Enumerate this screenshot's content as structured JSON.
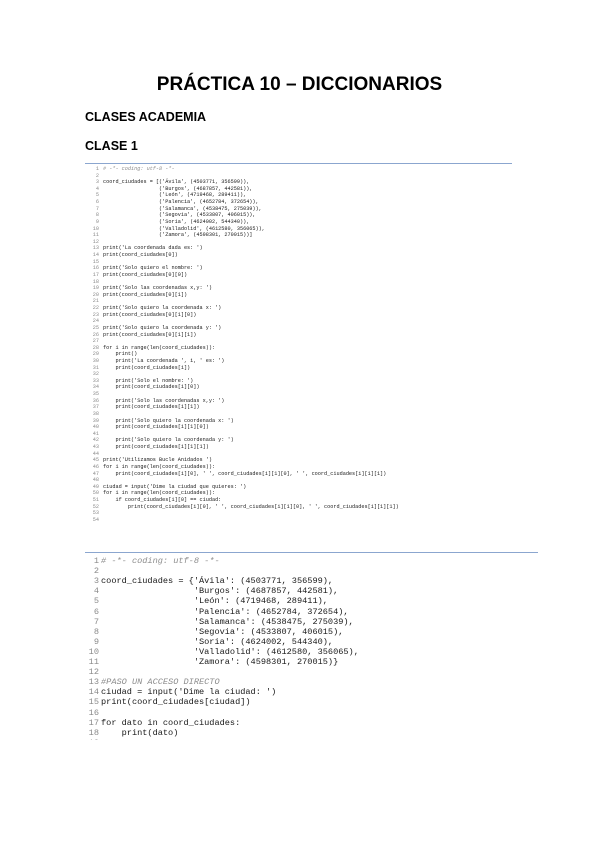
{
  "document": {
    "title": "PRÁCTICA 10 – DICCIONARIOS",
    "section_heading": "CLASES ACADEMIA",
    "subsection_heading": "CLASE 1"
  },
  "code_block_1": {
    "lines": [
      "# -*- coding: utf-8 -*-",
      "",
      "coord_ciudades = [('Ávila', (4503771, 356599)),",
      "                  ('Burgos', (4687857, 442581)),",
      "                  ('León', (4719468, 289411)),",
      "                  ('Palencia', (4652784, 372654)),",
      "                  ('Salamanca', (4538475, 275039)),",
      "                  ('Segovia', (4533807, 406015)),",
      "                  ('Soria', (4624002, 544340)),",
      "                  ('Valladolid', (4612580, 356065)),",
      "                  ('Zamora', (4598301, 270015))]",
      "",
      "print('La coordenada dada es: ')",
      "print(coord_ciudades[0])",
      "",
      "print('Solo quiero el nombre: ')",
      "print(coord_ciudades[0][0])",
      "",
      "print('Solo las coordenadas x,y: ')",
      "print(coord_ciudades[0][1])",
      "",
      "print('Solo quiero la coordenada x: ')",
      "print(coord_ciudades[0][1][0])",
      "",
      "print('Solo quiero la coordenada y: ')",
      "print(coord_ciudades[0][1][1])",
      "",
      "for i in range(len(coord_ciudades)):",
      "    print()",
      "    print('La coordenada ', i, ' es: ')",
      "    print(coord_ciudades[i])",
      "",
      "    print('Solo el nombre: ')",
      "    print(coord_ciudades[i][0])",
      "",
      "    print('Solo las coordenadas x,y: ')",
      "    print(coord_ciudades[i][1])",
      "",
      "    print('Solo quiero la coordenada x: ')",
      "    print(coord_ciudades[i][1][0])",
      "",
      "    print('Solo quiero la coordenada y: ')",
      "    print(coord_ciudades[i][1][1])",
      "",
      "print('Utilizamos Bucle Anidados ')",
      "for i in range(len(coord_ciudades)):",
      "    print(coord_ciudades[i][0], ' ', coord_ciudades[i][1][0], ' ', coord_ciudades[i][1][1])",
      "",
      "ciudad = input('Dime la ciudad que quieres: ')",
      "for i in range(len(coord_ciudades)):",
      "    if coord_ciudades[i][0] == ciudad:",
      "        print(coord_ciudades[i][0], ' ', coord_ciudades[i][1][0], ' ', coord_ciudades[i][1][1])",
      "",
      ""
    ]
  },
  "code_block_2": {
    "lines": [
      "# -*- coding: utf-8 -*-",
      "",
      "coord_ciudades = {'Ávila': (4503771, 356599),",
      "                  'Burgos': (4687857, 442581),",
      "                  'León': (4719468, 289411),",
      "                  'Palencia': (4652784, 372654),",
      "                  'Salamanca': (4538475, 275039),",
      "                  'Segovia': (4533807, 406015),",
      "                  'Soria': (4624002, 544340),",
      "                  'Valladolid': (4612580, 356065),",
      "                  'Zamora': (4598301, 270015)}",
      "",
      "#PASO UN ACCESO DIRECTO",
      "ciudad = input('Dime la ciudad: ')",
      "print(coord_ciudades[ciudad])",
      "",
      "for dato in coord_ciudades:",
      "    print(dato)",
      ""
    ]
  }
}
